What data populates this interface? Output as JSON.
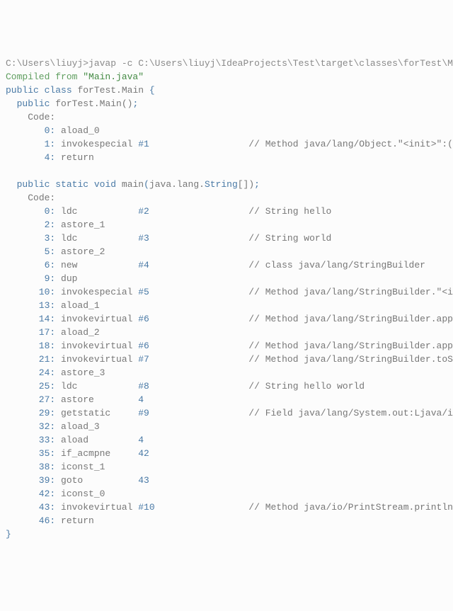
{
  "command": {
    "prompt": "C:\\Users\\liuyj>",
    "cmd": "javap -c C:\\Users\\liuyj\\IdeaProjects\\Test\\target\\classes\\forTest\\Main.cl"
  },
  "compiled_from": {
    "prefix": "Compiled from ",
    "file": "\"Main.java\""
  },
  "class_decl": {
    "kw1": "public",
    "kw2": "class",
    "name": "forTest.Main ",
    "brace": "{"
  },
  "ctor": {
    "kw": "public",
    "sig": "forTest.Main()",
    "semi": ";"
  },
  "code_label": "Code:",
  "ctor_lines": [
    {
      "off": "       0:",
      "instr": " aload_0",
      "ref": "",
      "cmt": ""
    },
    {
      "off": "       1:",
      "instr": " invokespecial ",
      "ref": "#1",
      "pad": "                  // ",
      "cmt": "Method java/lang/Object.\"<init>\":()V"
    },
    {
      "off": "       4:",
      "instr": " return",
      "ref": "",
      "cmt": ""
    }
  ],
  "main_decl": {
    "kw1": "public",
    "kw2": "static",
    "kw3": "void",
    "name": "main",
    "paren1": "(",
    "pkg": "java.lang.",
    "type": "String",
    "arr": "[])",
    "semi": ";"
  },
  "main_lines": [
    {
      "off": "       0:",
      "instr": " ldc           ",
      "ref": "#2",
      "pad": "                  // ",
      "cmt": "String hello"
    },
    {
      "off": "       2:",
      "instr": " astore_1",
      "ref": "",
      "cmt": ""
    },
    {
      "off": "       3:",
      "instr": " ldc           ",
      "ref": "#3",
      "pad": "                  // ",
      "cmt": "String world"
    },
    {
      "off": "       5:",
      "instr": " astore_2",
      "ref": "",
      "cmt": ""
    },
    {
      "off": "       6:",
      "instr": " new           ",
      "ref": "#4",
      "pad": "                  // ",
      "cmt": "class java/lang/StringBuilder"
    },
    {
      "off": "       9:",
      "instr": " dup",
      "ref": "",
      "cmt": ""
    },
    {
      "off": "      10:",
      "instr": " invokespecial ",
      "ref": "#5",
      "pad": "                  // ",
      "cmt": "Method java/lang/StringBuilder.\"<init>\":"
    },
    {
      "off": "      13:",
      "instr": " aload_1",
      "ref": "",
      "cmt": ""
    },
    {
      "off": "      14:",
      "instr": " invokevirtual ",
      "ref": "#6",
      "pad": "                  // ",
      "cmt": "Method java/lang/StringBuilder.append:(L"
    },
    {
      "off": "      17:",
      "instr": " aload_2",
      "ref": "",
      "cmt": ""
    },
    {
      "off": "      18:",
      "instr": " invokevirtual ",
      "ref": "#6",
      "pad": "                  // ",
      "cmt": "Method java/lang/StringBuilder.append:(L"
    },
    {
      "off": "      21:",
      "instr": " invokevirtual ",
      "ref": "#7",
      "pad": "                  // ",
      "cmt": "Method java/lang/StringBuilder.toString:"
    },
    {
      "off": "      24:",
      "instr": " astore_3",
      "ref": "",
      "cmt": ""
    },
    {
      "off": "      25:",
      "instr": " ldc           ",
      "ref": "#8",
      "pad": "                  // ",
      "cmt": "String hello world"
    },
    {
      "off": "      27:",
      "instr": " astore        ",
      "ref": "4",
      "cmt": ""
    },
    {
      "off": "      29:",
      "instr": " getstatic     ",
      "ref": "#9",
      "pad": "                  // ",
      "cmt": "Field java/lang/System.out:Ljava/io/Pri"
    },
    {
      "off": "      32:",
      "instr": " aload_3",
      "ref": "",
      "cmt": ""
    },
    {
      "off": "      33:",
      "instr": " aload         ",
      "ref": "4",
      "cmt": ""
    },
    {
      "off": "      35:",
      "instr": " if_acmpne     ",
      "ref": "42",
      "cmt": ""
    },
    {
      "off": "      38:",
      "instr": " iconst_1",
      "ref": "",
      "cmt": ""
    },
    {
      "off": "      39:",
      "instr": " goto          ",
      "ref": "43",
      "cmt": ""
    },
    {
      "off": "      42:",
      "instr": " iconst_0",
      "ref": "",
      "cmt": ""
    },
    {
      "off": "      43:",
      "instr": " invokevirtual ",
      "ref": "#10",
      "pad": "                 // ",
      "cmt": "Method java/io/PrintStream.println:(Z)V"
    },
    {
      "off": "      46:",
      "instr": " return",
      "ref": "",
      "cmt": ""
    }
  ],
  "close_brace": "}"
}
